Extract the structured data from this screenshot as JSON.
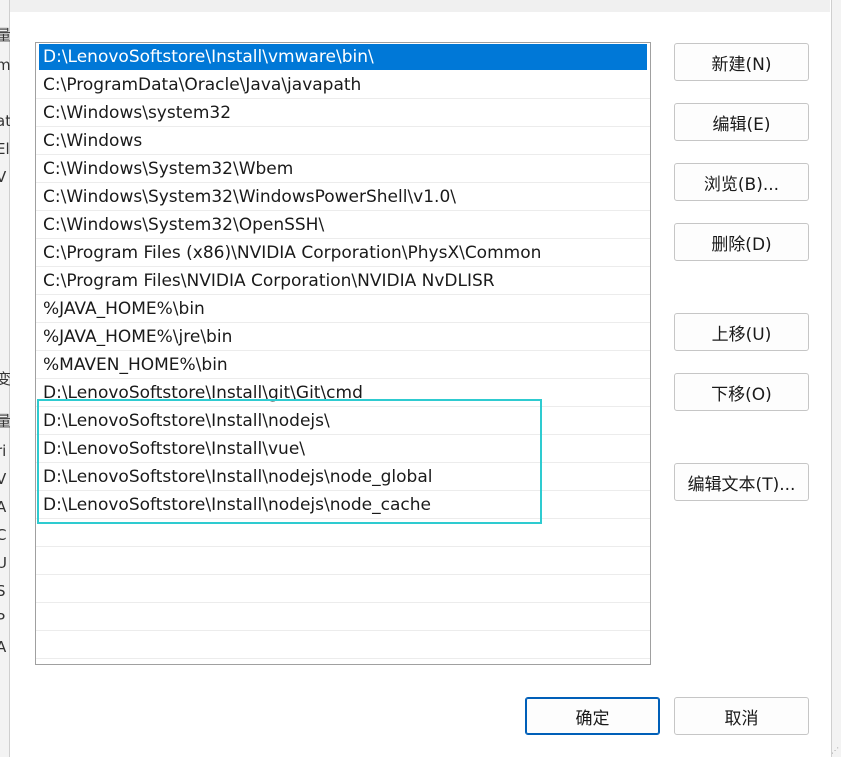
{
  "path_entries": [
    "D:\\LenovoSoftstore\\Install\\vmware\\bin\\",
    "C:\\ProgramData\\Oracle\\Java\\javapath",
    "C:\\Windows\\system32",
    "C:\\Windows",
    "C:\\Windows\\System32\\Wbem",
    "C:\\Windows\\System32\\WindowsPowerShell\\v1.0\\",
    "C:\\Windows\\System32\\OpenSSH\\",
    "C:\\Program Files (x86)\\NVIDIA Corporation\\PhysX\\Common",
    "C:\\Program Files\\NVIDIA Corporation\\NVIDIA NvDLISR",
    "%JAVA_HOME%\\bin",
    "%JAVA_HOME%\\jre\\bin",
    "%MAVEN_HOME%\\bin",
    "D:\\LenovoSoftstore\\Install\\git\\Git\\cmd",
    "D:\\LenovoSoftstore\\Install\\nodejs\\",
    "D:\\LenovoSoftstore\\Install\\vue\\",
    "D:\\LenovoSoftstore\\Install\\nodejs\\node_global",
    "D:\\LenovoSoftstore\\Install\\nodejs\\node_cache"
  ],
  "selected_index": 0,
  "buttons": {
    "new": "新建(N)",
    "edit": "编辑(E)",
    "browse": "浏览(B)...",
    "delete": "删除(D)",
    "move_up": "上移(U)",
    "move_down": "下移(O)",
    "edit_text": "编辑文本(T)...",
    "ok": "确定",
    "cancel": "取消"
  },
  "background_fragments": [
    "量",
    "m",
    "at",
    "El",
    "V",
    "变",
    "量",
    "ri",
    "V",
    "A",
    "C",
    "U",
    "S",
    "P",
    "A"
  ],
  "colors": {
    "selection": "#0078d7",
    "highlight_box": "#2ecbd0",
    "primary_border": "#005fb8"
  }
}
